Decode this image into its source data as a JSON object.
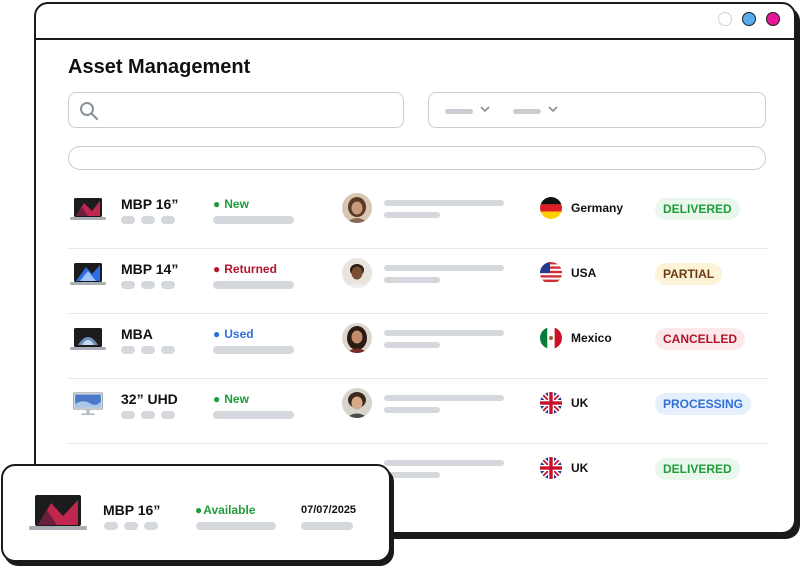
{
  "page": {
    "title": "Asset Management"
  },
  "search": {
    "value": "",
    "placeholder": ""
  },
  "rows": [
    {
      "device": "MBP 16”",
      "status": "New",
      "status_color": "#1f9d3a",
      "country": "Germany",
      "badge": "DELIVERED",
      "badge_color": "#1f9d3a",
      "badge_bg": "#eaf7ec"
    },
    {
      "device": "MBP 14”",
      "status": "Returned",
      "status_color": "#b3132b",
      "country": "USA",
      "badge": "PARTIAL",
      "badge_color": "#6b3b12",
      "badge_bg": "#fdf3d9"
    },
    {
      "device": "MBA",
      "status": "Used",
      "status_color": "#2f6fd8",
      "country": "Mexico",
      "badge": "CANCELLED",
      "badge_color": "#b3132b",
      "badge_bg": "#fbe8ea"
    },
    {
      "device": "32” UHD",
      "status": "New",
      "status_color": "#1f9d3a",
      "country": "UK",
      "badge": "PROCESSING",
      "badge_color": "#2f6fd8",
      "badge_bg": "#e6f0fd"
    },
    {
      "device": "",
      "status": "",
      "status_color": "#1f9d3a",
      "country": "UK",
      "badge": "DELIVERED",
      "badge_color": "#1f9d3a",
      "badge_bg": "#eaf7ec"
    }
  ],
  "popup": {
    "device": "MBP 16”",
    "status": "Available",
    "status_color": "#1f9d3a",
    "date": "07/07/2025"
  },
  "colors": {
    "dot_blue": "#5aaaf0",
    "dot_magenta": "#e6179b",
    "placeholder": "#d4d8dc"
  }
}
